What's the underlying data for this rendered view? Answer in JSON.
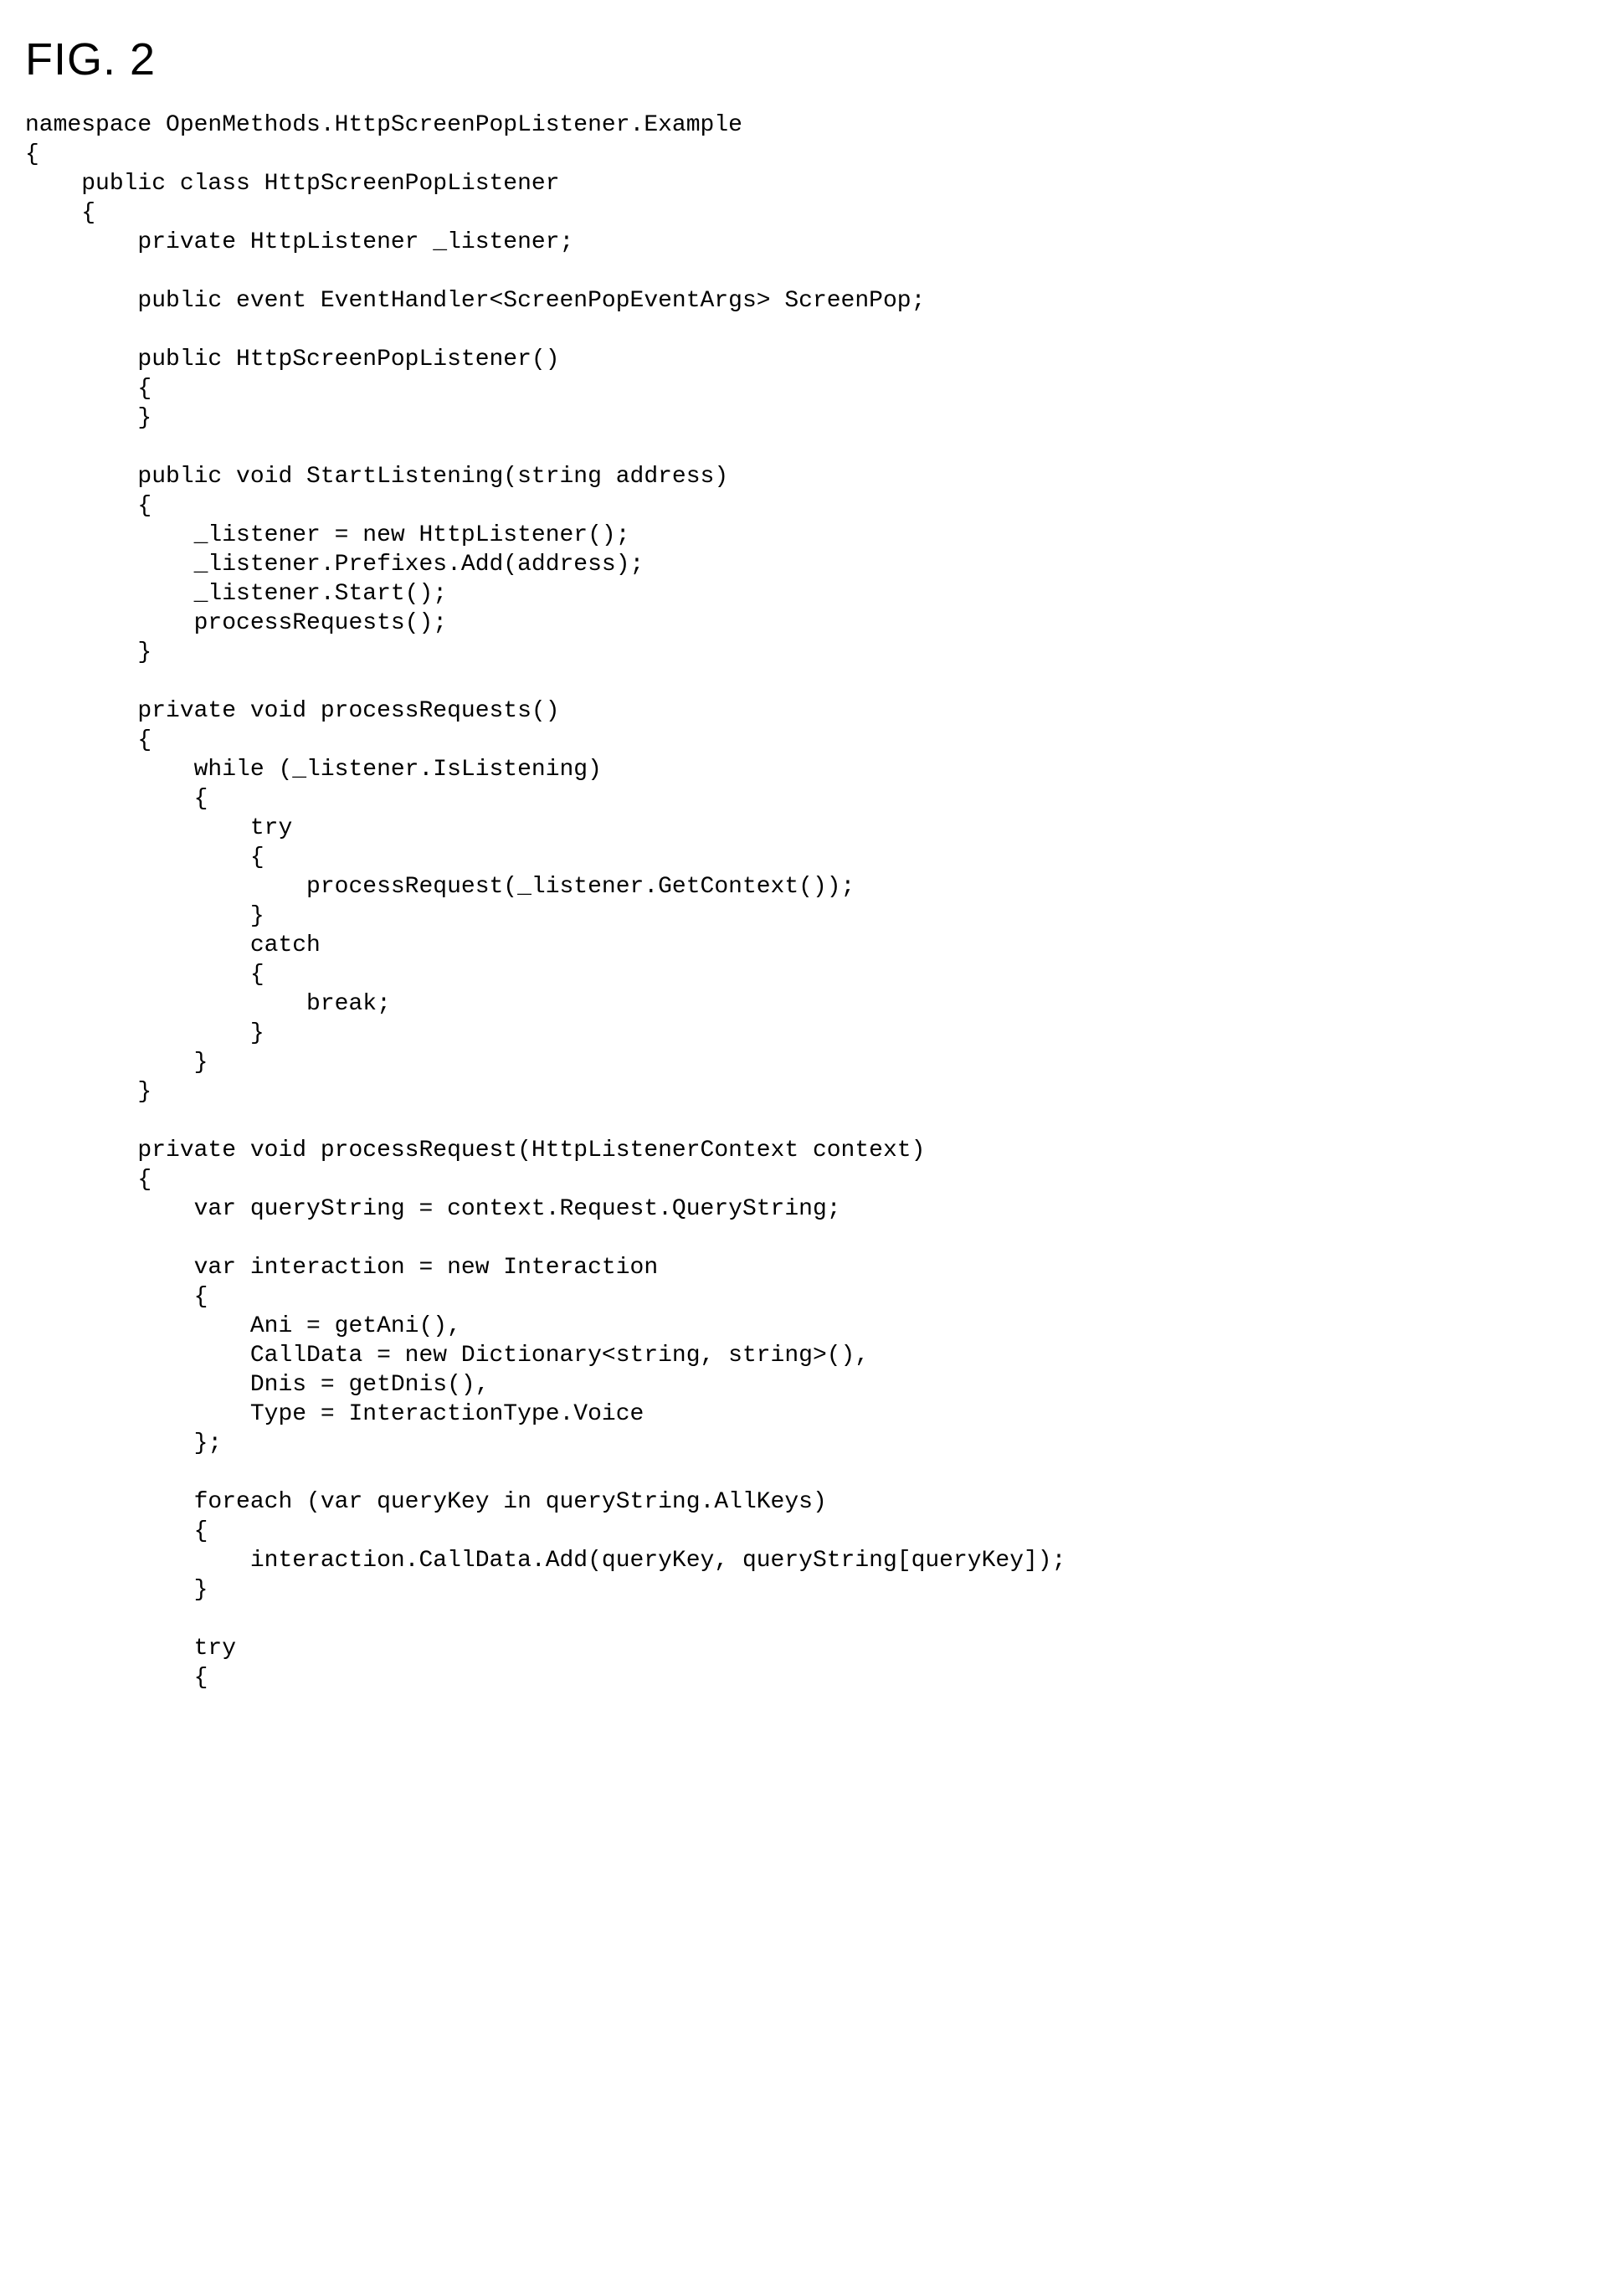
{
  "figure": {
    "title": "FIG. 2"
  },
  "code": {
    "lines": [
      "namespace OpenMethods.HttpScreenPopListener.Example",
      "{",
      "    public class HttpScreenPopListener",
      "    {",
      "        private HttpListener _listener;",
      "",
      "        public event EventHandler<ScreenPopEventArgs> ScreenPop;",
      "",
      "        public HttpScreenPopListener()",
      "        {",
      "        }",
      "",
      "        public void StartListening(string address)",
      "        {",
      "            _listener = new HttpListener();",
      "            _listener.Prefixes.Add(address);",
      "            _listener.Start();",
      "            processRequests();",
      "        }",
      "",
      "        private void processRequests()",
      "        {",
      "            while (_listener.IsListening)",
      "            {",
      "                try",
      "                {",
      "                    processRequest(_listener.GetContext());",
      "                }",
      "                catch",
      "                {",
      "                    break;",
      "                }",
      "            }",
      "        }",
      "",
      "        private void processRequest(HttpListenerContext context)",
      "        {",
      "            var queryString = context.Request.QueryString;",
      "",
      "            var interaction = new Interaction",
      "            {",
      "                Ani = getAni(),",
      "                CallData = new Dictionary<string, string>(),",
      "                Dnis = getDnis(),",
      "                Type = InteractionType.Voice",
      "            };",
      "",
      "            foreach (var queryKey in queryString.AllKeys)",
      "            {",
      "                interaction.CallData.Add(queryKey, queryString[queryKey]);",
      "            }",
      "",
      "            try",
      "            {"
    ]
  }
}
